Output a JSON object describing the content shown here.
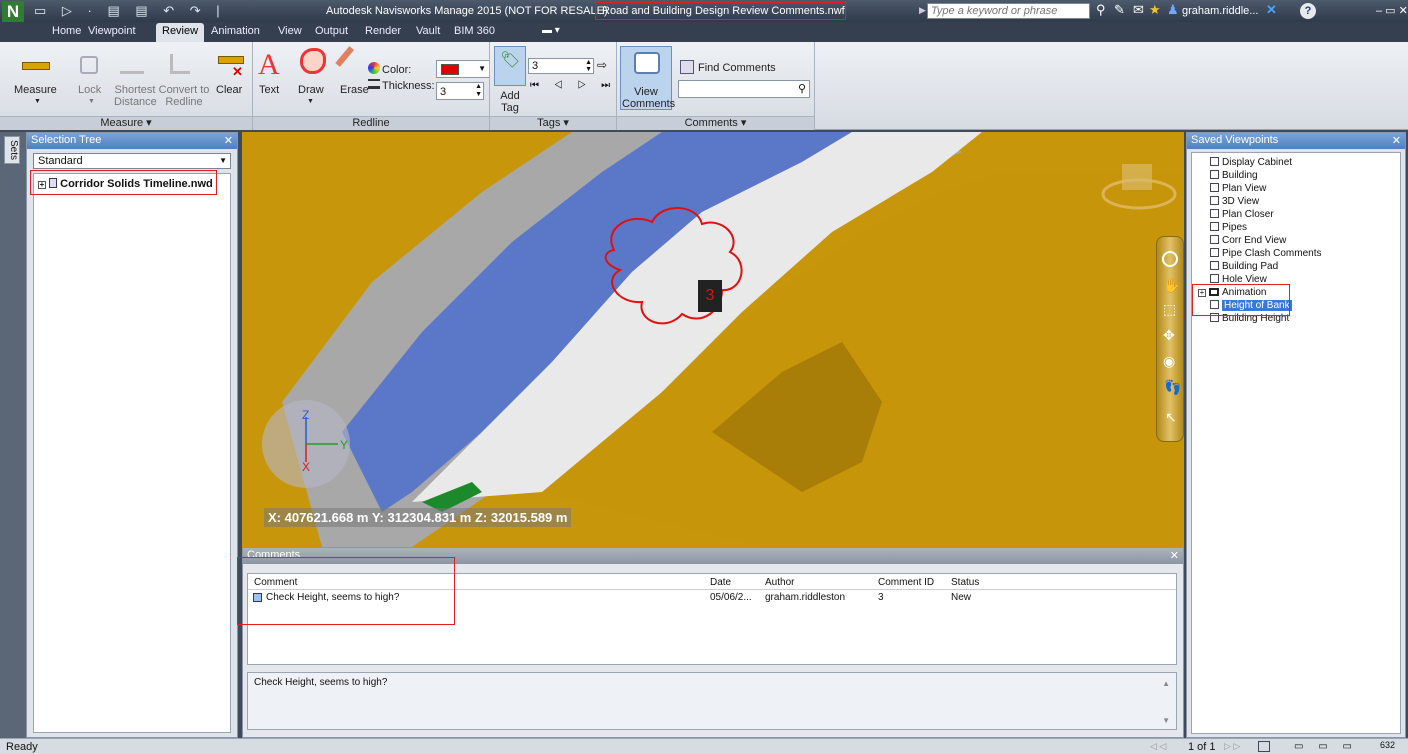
{
  "titlebar": {
    "app_title": "Autodesk Navisworks Manage 2015 (NOT FOR RESALE)",
    "file_title": "Road and Building Design Review Comments.nwf",
    "search_placeholder": "Type a keyword or phrase",
    "user": "graham.riddle..."
  },
  "tabs": [
    "Home",
    "Viewpoint",
    "Review",
    "Animation",
    "View",
    "Output",
    "Render",
    "Vault",
    "BIM 360"
  ],
  "ribbon": {
    "measure": {
      "measure": "Measure",
      "lock": "Lock",
      "shortest_distance": "Shortest Distance",
      "convert_to_redline": "Convert to Redline",
      "clear": "Clear",
      "panel": "Measure ▾"
    },
    "redline": {
      "text": "Text",
      "draw": "Draw",
      "erase": "Erase",
      "color_label": "Color:",
      "thickness_label": "Thickness:",
      "thickness_value": "3",
      "panel": "Redline",
      "color": "#e00000"
    },
    "tags": {
      "add_tag": "Add Tag",
      "tag_value": "3",
      "panel": "Tags ▾"
    },
    "comments": {
      "view_comments": "View Comments",
      "find_comments": "Find Comments",
      "find_value": "",
      "panel": "Comments ▾"
    }
  },
  "left_strip": {
    "sets": "Sets"
  },
  "selection_tree": {
    "title": "Selection Tree",
    "mode": "Standard",
    "root_item": "Corridor Solids Timeline.nwd"
  },
  "viewport": {
    "coords": "X: 407621.668 m  Y: 312304.831 m  Z: 32015.589 m",
    "tag_number": "3",
    "axis_z": "Z",
    "axis_y": "Y",
    "axis_x": "X"
  },
  "comments_panel": {
    "title": "Comments",
    "columns": [
      "Comment",
      "Date",
      "Author",
      "Comment ID",
      "Status"
    ],
    "rows": [
      {
        "comment": "Check Height, seems to high?",
        "date": "05/06/2...",
        "author": "graham.riddleston",
        "id": "3",
        "status": "New"
      }
    ],
    "detail_text": "Check Height, seems to high?"
  },
  "saved_viewpoints": {
    "title": "Saved Viewpoints",
    "items": [
      "Display Cabinet",
      "Building",
      "Plan View",
      "3D View",
      "Plan Closer",
      "Pipes",
      "Corr End View",
      "Pipe Clash Comments",
      "Building Pad",
      "Hole View",
      "Animation",
      "Height of Bank",
      "Building Height"
    ]
  },
  "statusbar": {
    "status": "Ready",
    "page": "1 of 1",
    "memory": "632"
  }
}
